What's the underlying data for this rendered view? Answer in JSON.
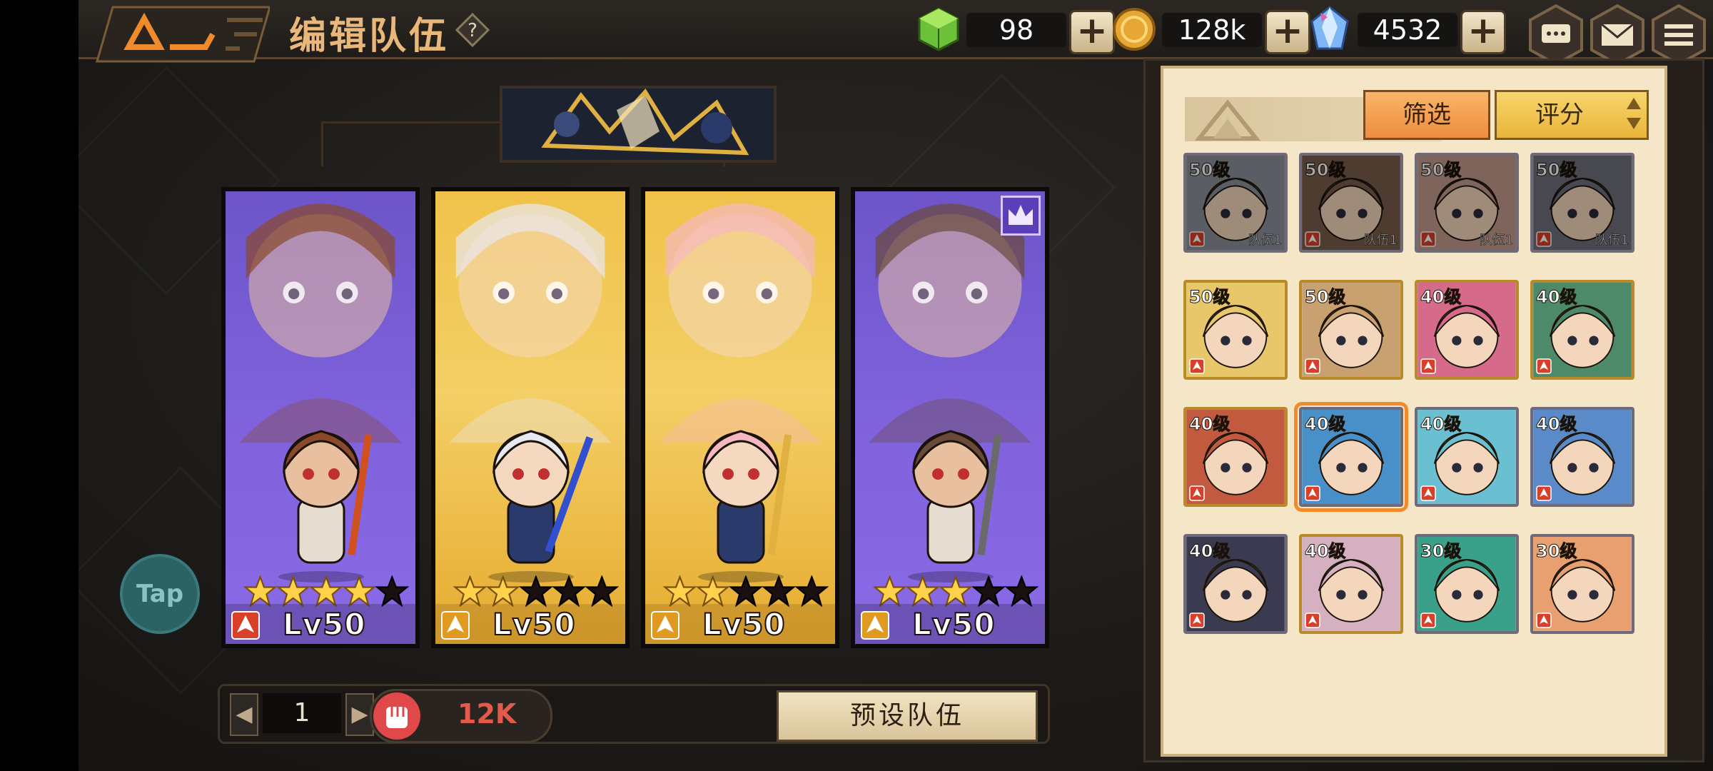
{
  "header": {
    "title": "编辑队伍",
    "help_label": "?"
  },
  "resources": [
    {
      "name": "stamina",
      "icon": "green-cube-icon",
      "value": "98"
    },
    {
      "name": "gold",
      "icon": "gold-coin-icon",
      "value": "128k"
    },
    {
      "name": "crystal",
      "icon": "crystal-icon",
      "value": "4532"
    }
  ],
  "plus_label": "+",
  "team": [
    {
      "name": "goggles-girl",
      "theme": "purple",
      "stars": 4,
      "level": "Lv50",
      "class_icon": "red-arrow-icon"
    },
    {
      "name": "silver-swordswoman",
      "theme": "gold",
      "stars": 2,
      "level": "Lv50",
      "class_icon": "gold-arrow-icon"
    },
    {
      "name": "pink-cleric",
      "theme": "gold",
      "stars": 2,
      "level": "Lv50",
      "class_icon": "gold-cross-icon"
    },
    {
      "name": "compass-boy",
      "theme": "purple",
      "stars": 3,
      "level": "Lv50",
      "class_icon": "gold-shield-icon",
      "leader": true
    }
  ],
  "bottom": {
    "prev": "◀",
    "page": "1",
    "next": "▶",
    "power": "12K",
    "preset_label": "预设队伍"
  },
  "tap_label": "Tap",
  "panel": {
    "filter_label": "筛选",
    "sort_label": "评分"
  },
  "roster": [
    {
      "level": "50级",
      "team": "队伍1",
      "frame": "slate",
      "dim": true,
      "color": "#8c8f9a"
    },
    {
      "level": "50级",
      "team": "队伍1",
      "frame": "slate",
      "dim": true,
      "color": "#7a5c4a"
    },
    {
      "level": "50级",
      "team": "队伍1",
      "frame": "slate",
      "dim": true,
      "color": "#c49a8e"
    },
    {
      "level": "50级",
      "team": "队伍1",
      "frame": "slate",
      "dim": true,
      "color": "#6f6f7d"
    },
    {
      "level": "50级",
      "team": "",
      "frame": "gold",
      "color": "#e7c76a"
    },
    {
      "level": "50级",
      "team": "",
      "frame": "gold",
      "color": "#c9a070"
    },
    {
      "level": "40级",
      "team": "",
      "frame": "gold",
      "color": "#d66a8a"
    },
    {
      "level": "40级",
      "team": "",
      "frame": "gold",
      "color": "#4c8a6a"
    },
    {
      "level": "40级",
      "team": "",
      "frame": "gold",
      "color": "#c25a40"
    },
    {
      "level": "40级",
      "team": "",
      "frame": "slate",
      "color": "#4a90c8",
      "selected": true
    },
    {
      "level": "40级",
      "team": "",
      "frame": "slate",
      "color": "#6ac0d0"
    },
    {
      "level": "40级",
      "team": "",
      "frame": "slate",
      "color": "#5a8ac8"
    },
    {
      "level": "40级",
      "team": "",
      "frame": "slate",
      "color": "#3a3a50"
    },
    {
      "level": "40级",
      "team": "",
      "frame": "gold",
      "color": "#d4b0c0"
    },
    {
      "level": "30级",
      "team": "",
      "frame": "slate",
      "color": "#3aa08a"
    },
    {
      "level": "30级",
      "team": "",
      "frame": "slate",
      "color": "#e8a070"
    }
  ]
}
